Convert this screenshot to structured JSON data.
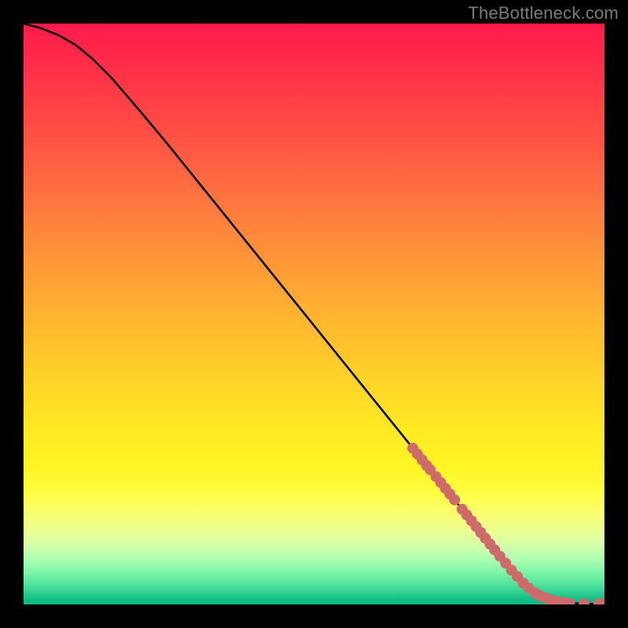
{
  "watermark": "TheBottleneck.com",
  "chart_data": {
    "type": "line",
    "title": "",
    "xlabel": "",
    "ylabel": "",
    "xlim": [
      0,
      100
    ],
    "ylim": [
      0,
      100
    ],
    "series": [
      {
        "name": "curve",
        "x": [
          0,
          3,
          6,
          9,
          12,
          15,
          20,
          25,
          30,
          35,
          40,
          45,
          50,
          55,
          60,
          65,
          70,
          75,
          80,
          82,
          84,
          86,
          88,
          90,
          92,
          94,
          96,
          98,
          100
        ],
        "y": [
          100,
          99.2,
          98.0,
          96.3,
          93.8,
          90.8,
          85.0,
          79.0,
          72.8,
          66.6,
          60.4,
          54.2,
          48.0,
          41.8,
          35.6,
          29.4,
          23.2,
          17.0,
          10.8,
          8.3,
          5.9,
          3.7,
          2.0,
          1.0,
          0.45,
          0.25,
          0.15,
          0.1,
          0.1
        ]
      }
    ],
    "markers": [
      {
        "x": 67.0,
        "y": 26.9
      },
      {
        "x": 67.8,
        "y": 25.9
      },
      {
        "x": 68.6,
        "y": 24.9
      },
      {
        "x": 69.4,
        "y": 23.9
      },
      {
        "x": 70.0,
        "y": 23.2
      },
      {
        "x": 71.0,
        "y": 22.0
      },
      {
        "x": 71.8,
        "y": 21.0
      },
      {
        "x": 72.6,
        "y": 20.0
      },
      {
        "x": 73.4,
        "y": 19.0
      },
      {
        "x": 74.2,
        "y": 18.0
      },
      {
        "x": 75.5,
        "y": 16.4
      },
      {
        "x": 76.3,
        "y": 15.4
      },
      {
        "x": 77.1,
        "y": 14.4
      },
      {
        "x": 77.9,
        "y": 13.4
      },
      {
        "x": 78.7,
        "y": 12.4
      },
      {
        "x": 79.5,
        "y": 11.4
      },
      {
        "x": 80.3,
        "y": 10.4
      },
      {
        "x": 81.1,
        "y": 9.4
      },
      {
        "x": 82.0,
        "y": 8.3
      },
      {
        "x": 83.0,
        "y": 7.1
      },
      {
        "x": 84.0,
        "y": 5.9
      },
      {
        "x": 85.0,
        "y": 4.8
      },
      {
        "x": 86.0,
        "y": 3.7
      },
      {
        "x": 87.0,
        "y": 2.8
      },
      {
        "x": 88.0,
        "y": 2.0
      },
      {
        "x": 88.8,
        "y": 1.55
      },
      {
        "x": 89.6,
        "y": 1.2
      },
      {
        "x": 90.4,
        "y": 0.9
      },
      {
        "x": 91.2,
        "y": 0.65
      },
      {
        "x": 92.0,
        "y": 0.45
      },
      {
        "x": 93.0,
        "y": 0.35
      },
      {
        "x": 94.0,
        "y": 0.25
      },
      {
        "x": 96.5,
        "y": 0.15
      },
      {
        "x": 99.0,
        "y": 0.1
      },
      {
        "x": 100.0,
        "y": 0.1
      }
    ],
    "marker_radius_px": 7
  }
}
